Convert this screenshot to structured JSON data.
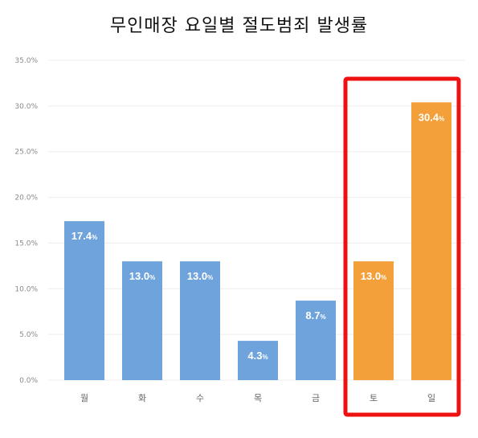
{
  "title": "무인매장 요일별 절도범죄 발생률",
  "chart_data": {
    "type": "bar",
    "title": "무인매장 요일별 절도범죄 발생률",
    "categories": [
      "월",
      "화",
      "수",
      "목",
      "금",
      "토",
      "일"
    ],
    "values": [
      17.4,
      13.0,
      13.0,
      4.3,
      8.7,
      13.0,
      30.4
    ],
    "data_labels": [
      "17.4",
      "13.0",
      "13.0",
      "4.3",
      "8.7",
      "13.0",
      "30.4"
    ],
    "data_label_unit": "%",
    "y_ticks": [
      "0.0%",
      "5.0%",
      "10.0%",
      "15.0%",
      "20.0%",
      "25.0%",
      "30.0%",
      "35.0%"
    ],
    "ylim": [
      0,
      35
    ],
    "xlabel": "",
    "ylabel": "",
    "grid": true,
    "colors": {
      "weekday": "#6fa3dc",
      "weekend": "#f4a03a",
      "highlight_box": "#ee1111",
      "grid": "#ececec"
    },
    "highlighted_categories": [
      "토",
      "일"
    ]
  }
}
